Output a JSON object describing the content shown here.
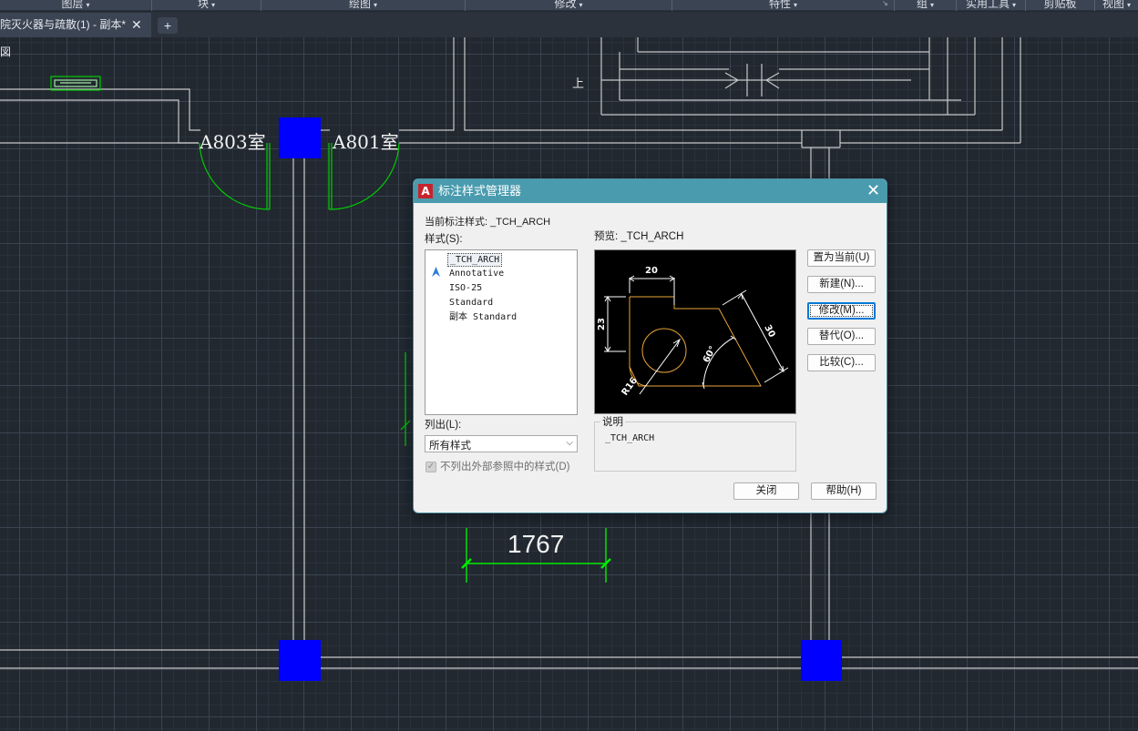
{
  "ribbon": {
    "panels": [
      "图层",
      "块",
      "绘图",
      "修改",
      "特性",
      "组",
      "实用工具",
      "剪贴板",
      "视图"
    ]
  },
  "tabs": {
    "doc_title": "院灭火器与疏散(1) - 副本*",
    "close_glyph": "✕",
    "new_tab_glyph": "+"
  },
  "canvas": {
    "view_label": "図",
    "room_labels": [
      "A803室",
      "A801室"
    ],
    "stair_label": "上",
    "dimension_value": "1767",
    "colors": {
      "background": "#212830",
      "walls": "#c8c8c8",
      "column": "#0000ff",
      "door_swing": "#00cc00",
      "dimension": "#00ff00"
    }
  },
  "dialog": {
    "title": "标注样式管理器",
    "logo_letter": "A",
    "close_glyph": "✕",
    "current_style_label": "当前标注样式: _TCH_ARCH",
    "styles_label": "样式(S):",
    "styles": [
      "_TCH_ARCH",
      "Annotative",
      "ISO-25",
      "Standard",
      "副本 Standard"
    ],
    "selected_style": "_TCH_ARCH",
    "preview_label": "预览: _TCH_ARCH",
    "list_label": "列出(L):",
    "list_value": "所有样式",
    "xref_checkbox_label": "不列出外部参照中的样式(D)",
    "xref_checked": true,
    "description_legend": "说明",
    "description_text": "_TCH_ARCH",
    "buttons": {
      "set_current": "置为当前(U)",
      "new": "新建(N)...",
      "modify": "修改(M)...",
      "override": "替代(O)...",
      "compare": "比较(C)...",
      "close": "关闭",
      "help": "帮助(H)"
    },
    "preview_dims": {
      "top": "20",
      "left": "23",
      "slant": "30",
      "angle": "60°",
      "radius": "R16"
    },
    "colors": {
      "title_bar": "#4a9bae",
      "preview_bg": "#000000",
      "preview_shape": "#e8a33a",
      "preview_dims": "#ffffff"
    }
  }
}
